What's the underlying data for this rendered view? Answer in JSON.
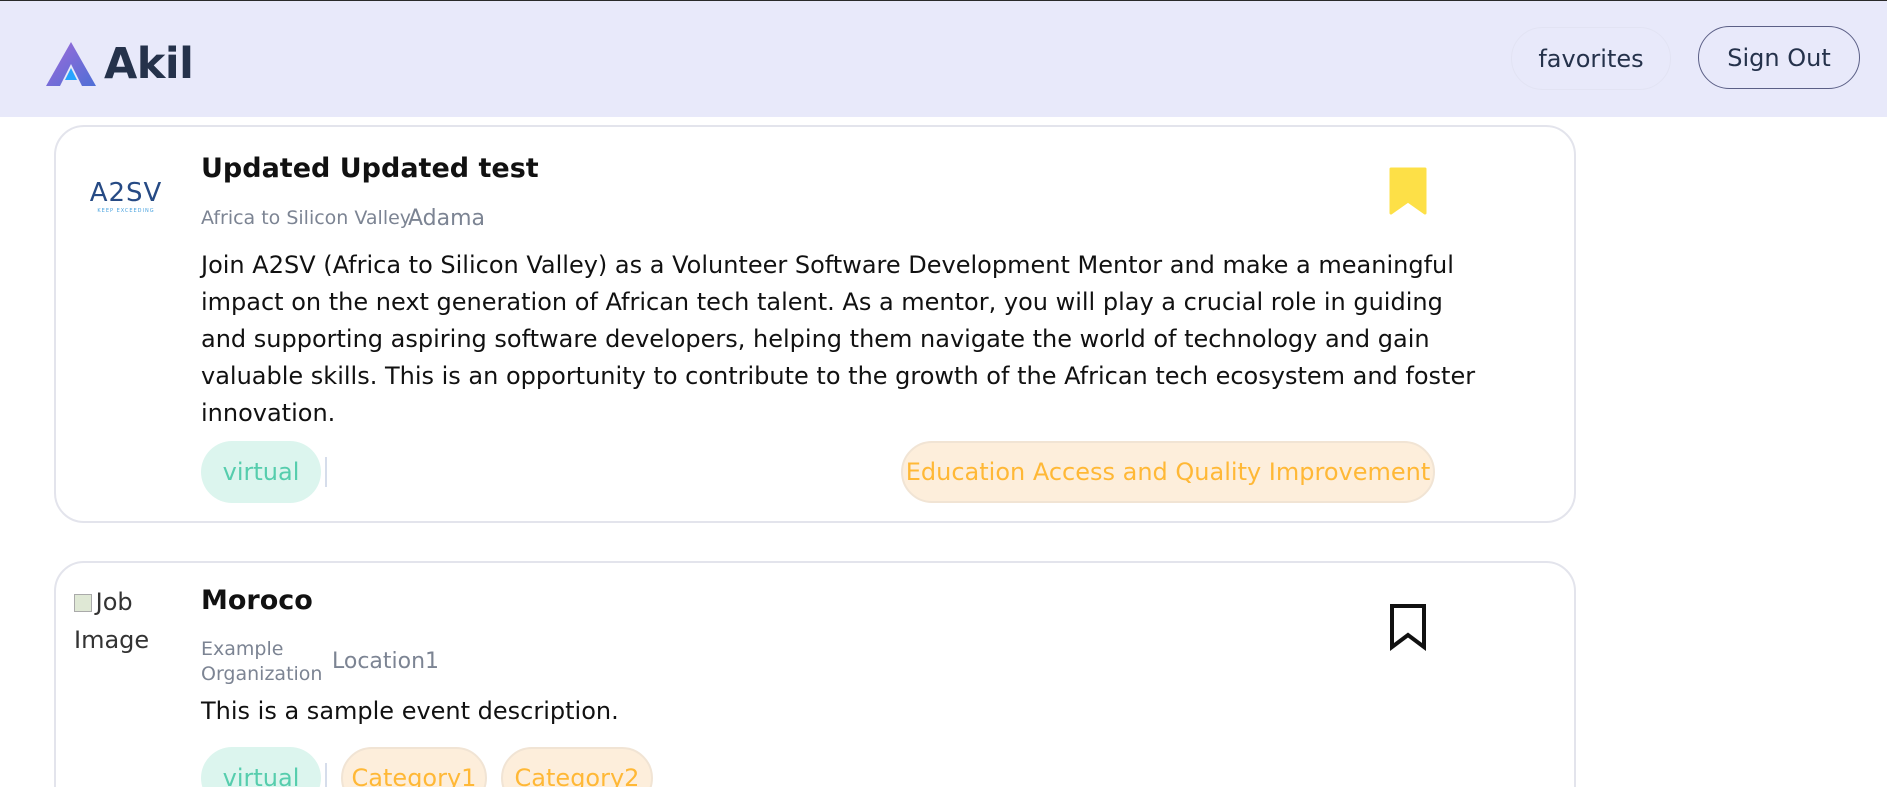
{
  "header": {
    "brand": "Akil",
    "favorites_label": "favorites",
    "signout_label": "Sign Out"
  },
  "colors": {
    "header_bg": "#e8e9fa",
    "brand_text": "#25324b",
    "bookmark_filled": "#fde047",
    "tag_green_text": "#56cdad",
    "tag_orange_text": "#ffb836"
  },
  "cards": [
    {
      "title": "Updated Updated test",
      "organization": "Africa to Silicon Valley",
      "location": "Adama",
      "logo_text": "A2SV",
      "logo_tagline": "KEEP EXCEEDING",
      "description": "Join A2SV (Africa to Silicon Valley) as a Volunteer Software Development Mentor and make a meaningful impact on the next generation of African tech talent. As a mentor, you will play a crucial role in guiding and supporting aspiring software developers, helping them navigate the world of technology and gain valuable skills. This is an opportunity to contribute to the growth of the African tech ecosystem and foster innovation.",
      "bookmarked": true,
      "tags": {
        "mode": "virtual",
        "categories": [
          "Education Access and Quality Improvement"
        ]
      }
    },
    {
      "title": "Moroco",
      "organization": "Example Organization",
      "location": "Location1",
      "image_alt": "Job Image",
      "description": "This is a sample event description.",
      "bookmarked": false,
      "tags": {
        "mode": "virtual",
        "categories": [
          "Category1",
          "Category2"
        ]
      }
    }
  ]
}
